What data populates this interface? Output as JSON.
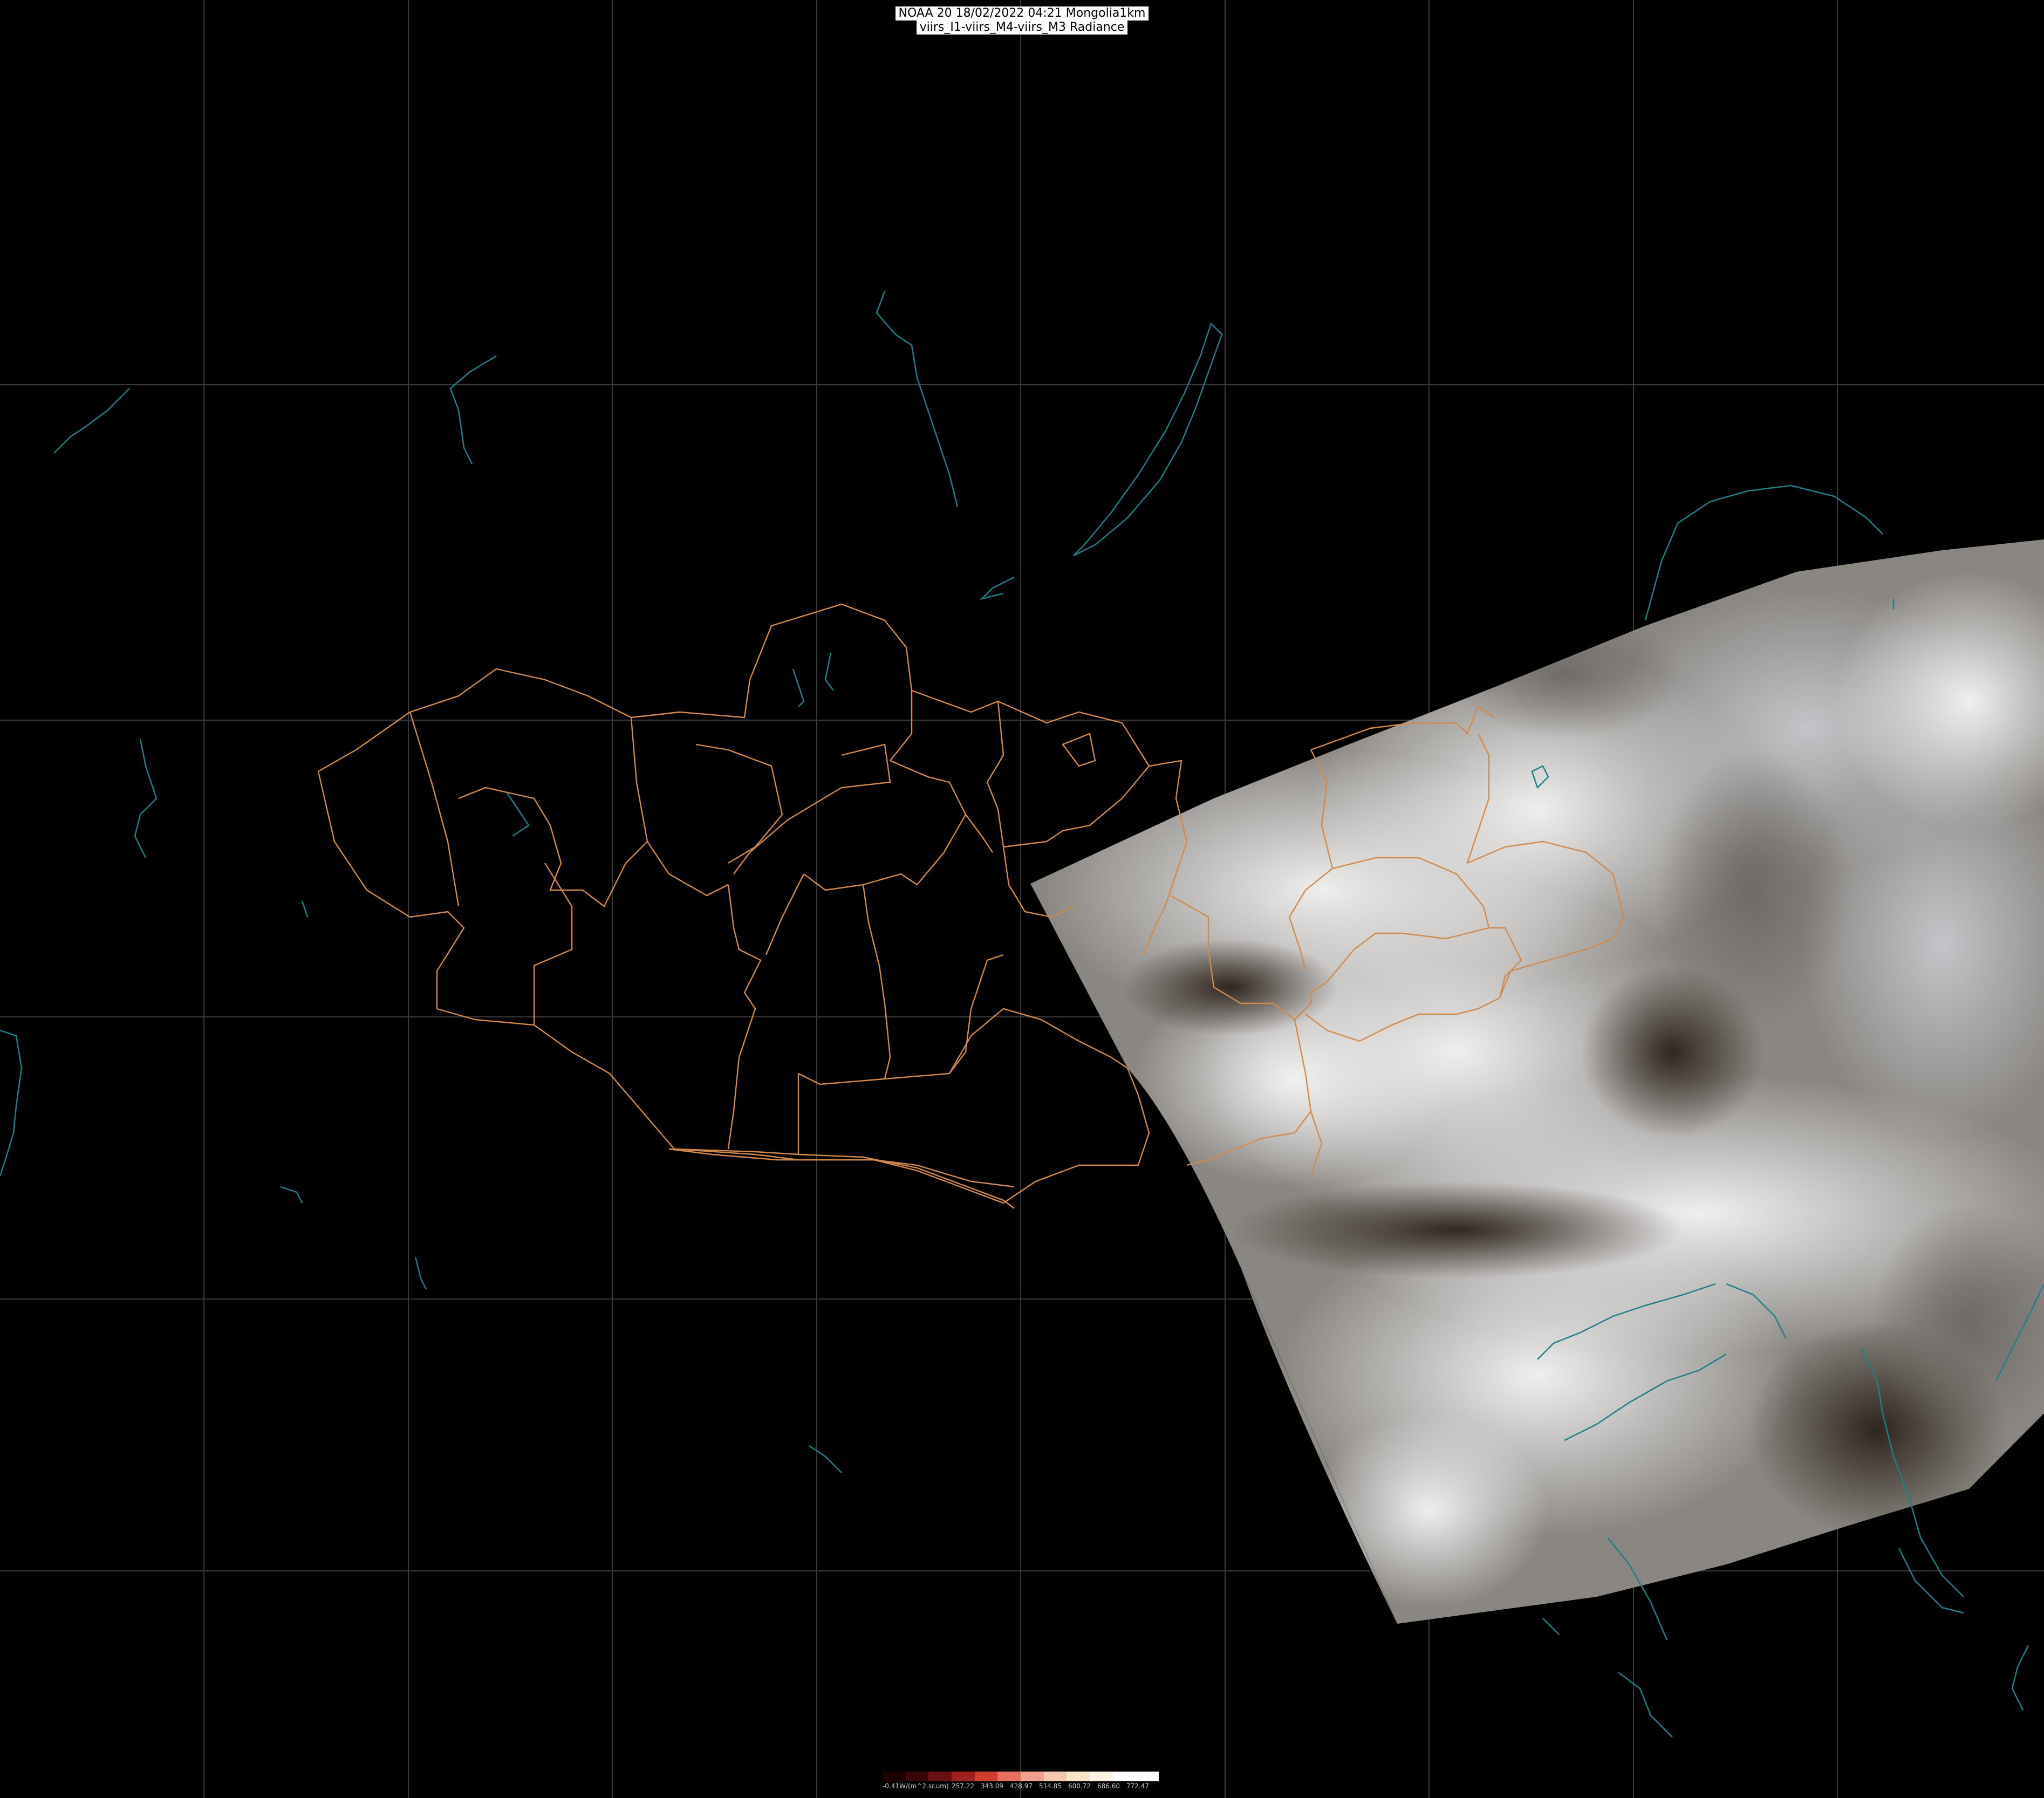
{
  "header": {
    "title_line1": "NOAA 20 18/02/2022 04:21 Mongolia1km",
    "title_line2": "viirs_I1-viirs_M4-viirs_M3 Radiance"
  },
  "colors": {
    "background": "#000000",
    "graticule": "#3a3a3a",
    "coastline": "#1f7f86",
    "province_border": "#d28a4a"
  },
  "legend": {
    "ticks": [
      "-0.41W/(m^2.sr.um)",
      "257.22",
      "343.09",
      "428.97",
      "514.85",
      "600.72",
      "686.60",
      "772.47"
    ],
    "colors": [
      "#1a0000",
      "#3a0505",
      "#6a1010",
      "#a02020",
      "#d04030",
      "#e87060",
      "#f2a090",
      "#f6c8b0",
      "#f8e6c8",
      "#fbf4e4",
      "#ffffff",
      "#ffffff"
    ]
  }
}
